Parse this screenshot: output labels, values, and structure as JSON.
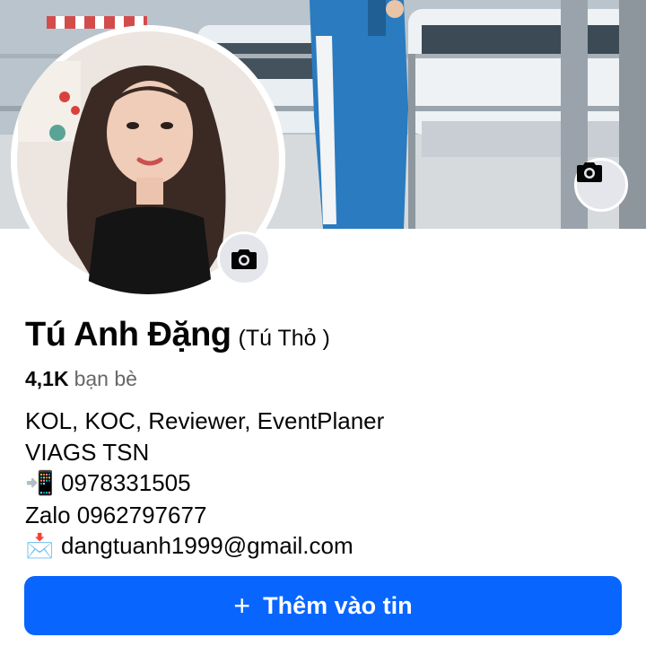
{
  "profile": {
    "name": "Tú Anh Đặng",
    "alternate_name": "(Tú Thỏ )",
    "friends_count": "4,1K",
    "friends_label": "bạn bè"
  },
  "bio": {
    "line1": "KOL, KOC, Reviewer, EventPlaner",
    "line2": "VIAGS TSN",
    "phone_icon": "📲",
    "phone": "0978331505",
    "line4": "Zalo 0962797677",
    "email_icon": "📩",
    "email": "dangtuanh1999@gmail.com"
  },
  "actions": {
    "add_story_icon": "+",
    "add_story_label": "Thêm vào tin"
  },
  "icons": {
    "cover_camera": "camera-icon",
    "avatar_camera": "camera-icon"
  },
  "colors": {
    "primary": "#0866ff",
    "secondary_text": "#65676b",
    "icon_button_bg": "#e4e6eb"
  }
}
